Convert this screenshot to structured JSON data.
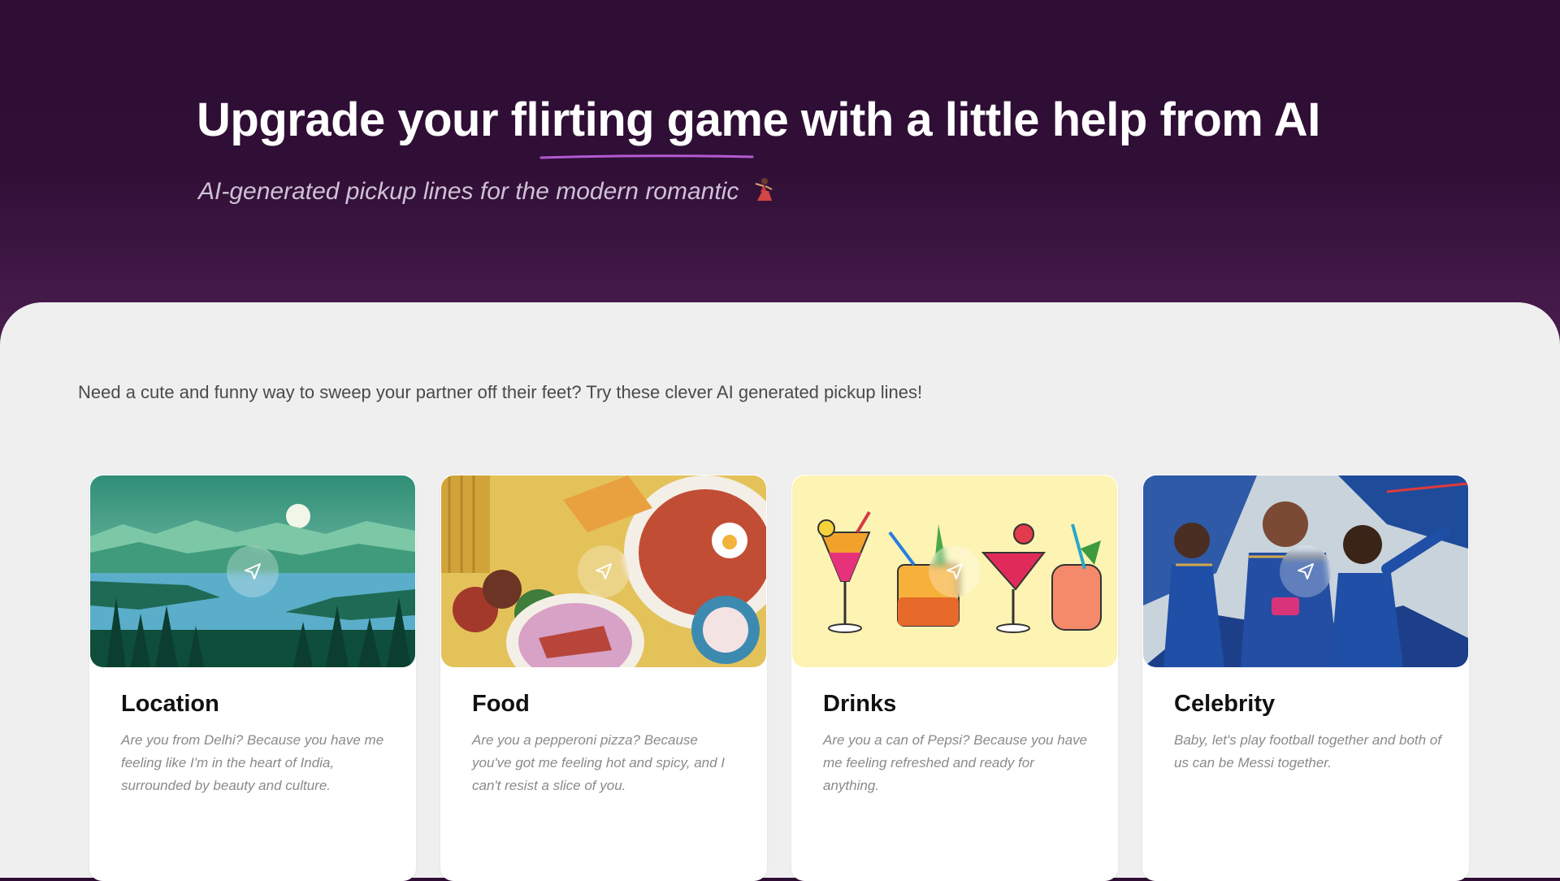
{
  "hero": {
    "title": "Upgrade your flirting game with a little help from AI",
    "subtitle": "AI-generated pickup lines for the modern romantic",
    "subtitle_icon": "dancer-icon"
  },
  "intro": "Need a cute and funny way to sweep your partner off their feet? Try these clever AI generated pickup lines!",
  "cards": [
    {
      "title": "Location",
      "text": "Are you from Delhi? Because you have me feeling like I'm in the heart of India, surrounded by beauty and culture.",
      "image": "landscape-lake-mountains",
      "icon": "send-icon"
    },
    {
      "title": "Food",
      "text": "Are you a pepperoni pizza? Because you've got me feeling hot and spicy, and I can't resist a slice of you.",
      "image": "food-plates",
      "icon": "send-icon"
    },
    {
      "title": "Drinks",
      "text": "Are you a can of Pepsi? Because you have me feeling refreshed and ready for anything.",
      "image": "cocktails",
      "icon": "send-icon"
    },
    {
      "title": "Celebrity",
      "text": "Baby, let's play football together and both of us can be Messi together.",
      "image": "cricket-players",
      "icon": "send-icon"
    }
  ],
  "colors": {
    "hero_bg": "#2f0e34",
    "panel_bg": "#efefef",
    "underline": "#b25ad1"
  }
}
